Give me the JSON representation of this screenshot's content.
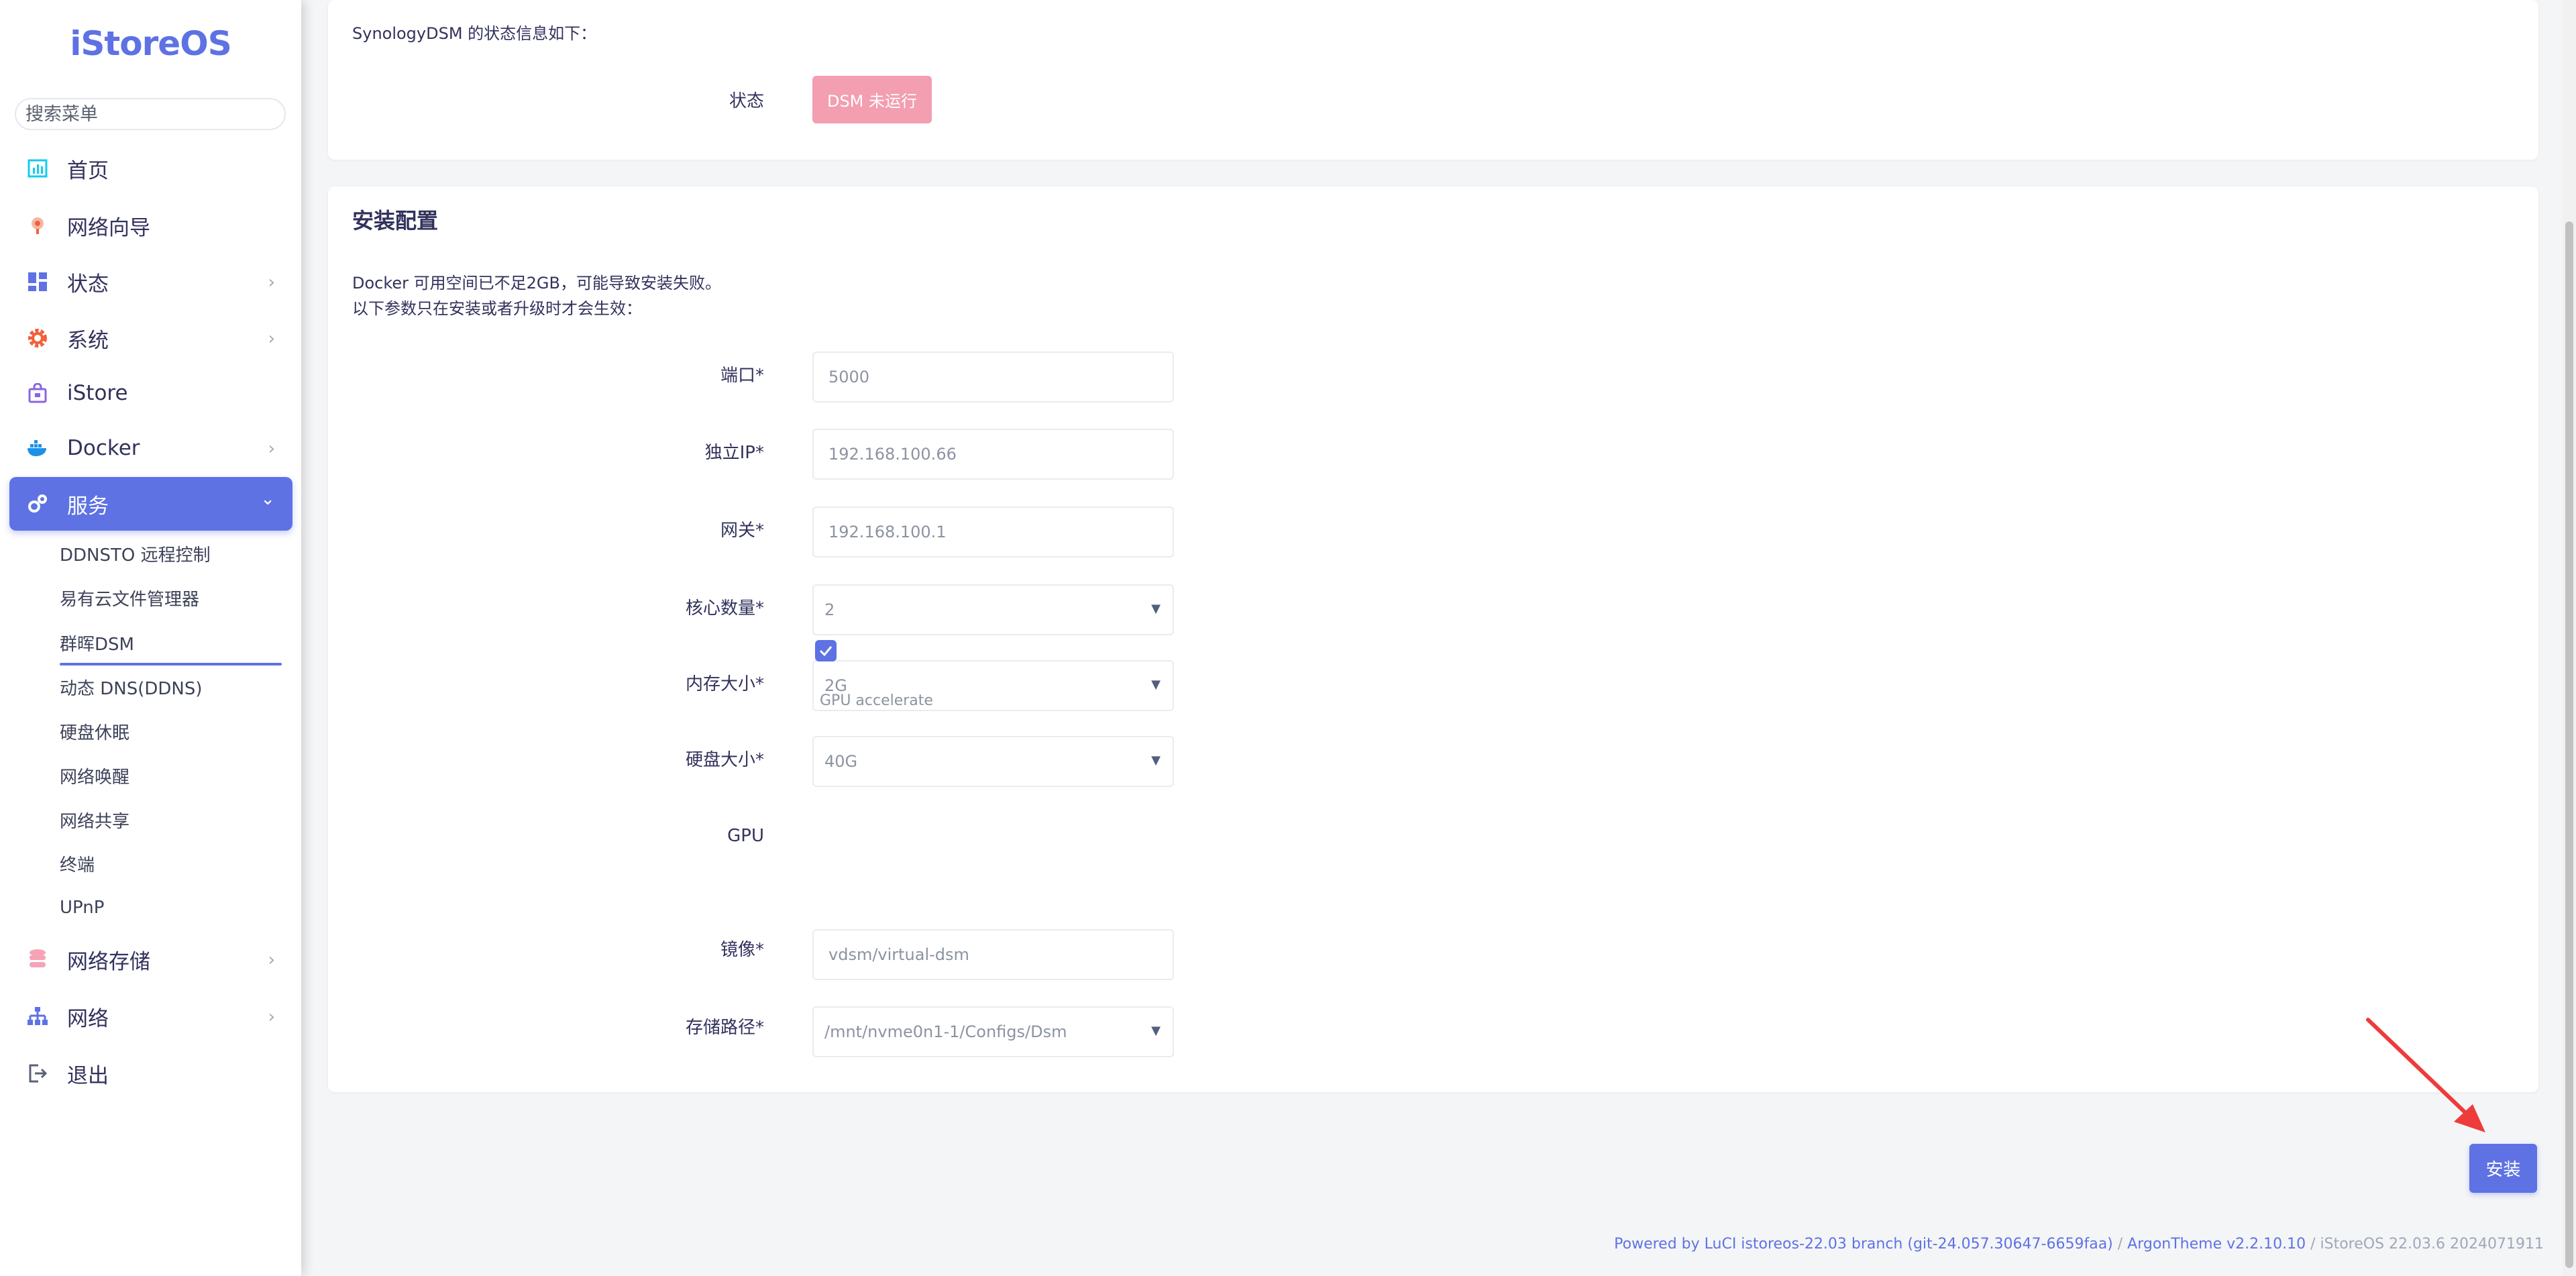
{
  "brand": {
    "logo": "iStoreOS"
  },
  "sidebar": {
    "search_placeholder": "搜索菜单",
    "items": [
      {
        "label": "首页",
        "icon": "home-chart-icon"
      },
      {
        "label": "网络向导",
        "icon": "wizard-icon"
      },
      {
        "label": "状态",
        "icon": "status-grid-icon",
        "chevron": "›"
      },
      {
        "label": "系统",
        "icon": "gear-icon",
        "chevron": "›"
      },
      {
        "label": "iStore",
        "icon": "store-bag-icon"
      },
      {
        "label": "Docker",
        "icon": "docker-icon",
        "chevron": "›"
      },
      {
        "label": "服务",
        "icon": "services-icon",
        "chevron": "⌄",
        "active": true
      },
      {
        "label": "网络存储",
        "icon": "storage-icon",
        "chevron": "›"
      },
      {
        "label": "网络",
        "icon": "network-tree-icon",
        "chevron": "›"
      },
      {
        "label": "退出",
        "icon": "logout-icon"
      }
    ],
    "sub_items": [
      "DDNSTO 远程控制",
      "易有云文件管理器",
      "群晖DSM",
      "动态 DNS(DDNS)",
      "硬盘休眠",
      "网络唤醒",
      "网络共享",
      "终端",
      "UPnP"
    ]
  },
  "status_card": {
    "intro": "SynologyDSM 的状态信息如下：",
    "label": "状态",
    "badge": "DSM 未运行",
    "badge_color": "#f39eb1"
  },
  "config_card": {
    "title": "安装配置",
    "notice_line1": "Docker 可用空间已不足2GB，可能导致安装失败。",
    "notice_line2": "以下参数只在安装或者升级时才会生效：",
    "port": {
      "label": "端口*",
      "value": "5000"
    },
    "ip": {
      "label": "独立IP*",
      "value": "192.168.100.66"
    },
    "gateway": {
      "label": "网关*",
      "value": "192.168.100.1"
    },
    "cpu": {
      "label": "核心数量*",
      "value": "2"
    },
    "memory": {
      "label": "内存大小*",
      "value": "2G"
    },
    "disk": {
      "label": "硬盘大小*",
      "value": "40G"
    },
    "gpu": {
      "label": "GPU",
      "checked": true,
      "hint": "GPU accelerate"
    },
    "image": {
      "label": "镜像*",
      "value": "vdsm/virtual-dsm"
    },
    "storage": {
      "label": "存储路径*",
      "value": "/mnt/nvme0n1-1/Configs/Dsm"
    }
  },
  "actions": {
    "install": "安装"
  },
  "footer": {
    "luci": "Powered by LuCI istoreos-22.03 branch (git-24.057.30647-6659faa)",
    "sep1": " / ",
    "theme": "ArgonTheme v2.2.10.10",
    "sep2": " / ",
    "version": "iStoreOS 22.03.6 2024071911"
  },
  "colors": {
    "accent": "#5e72e4",
    "annotation_arrow": "#ee3b3b"
  }
}
